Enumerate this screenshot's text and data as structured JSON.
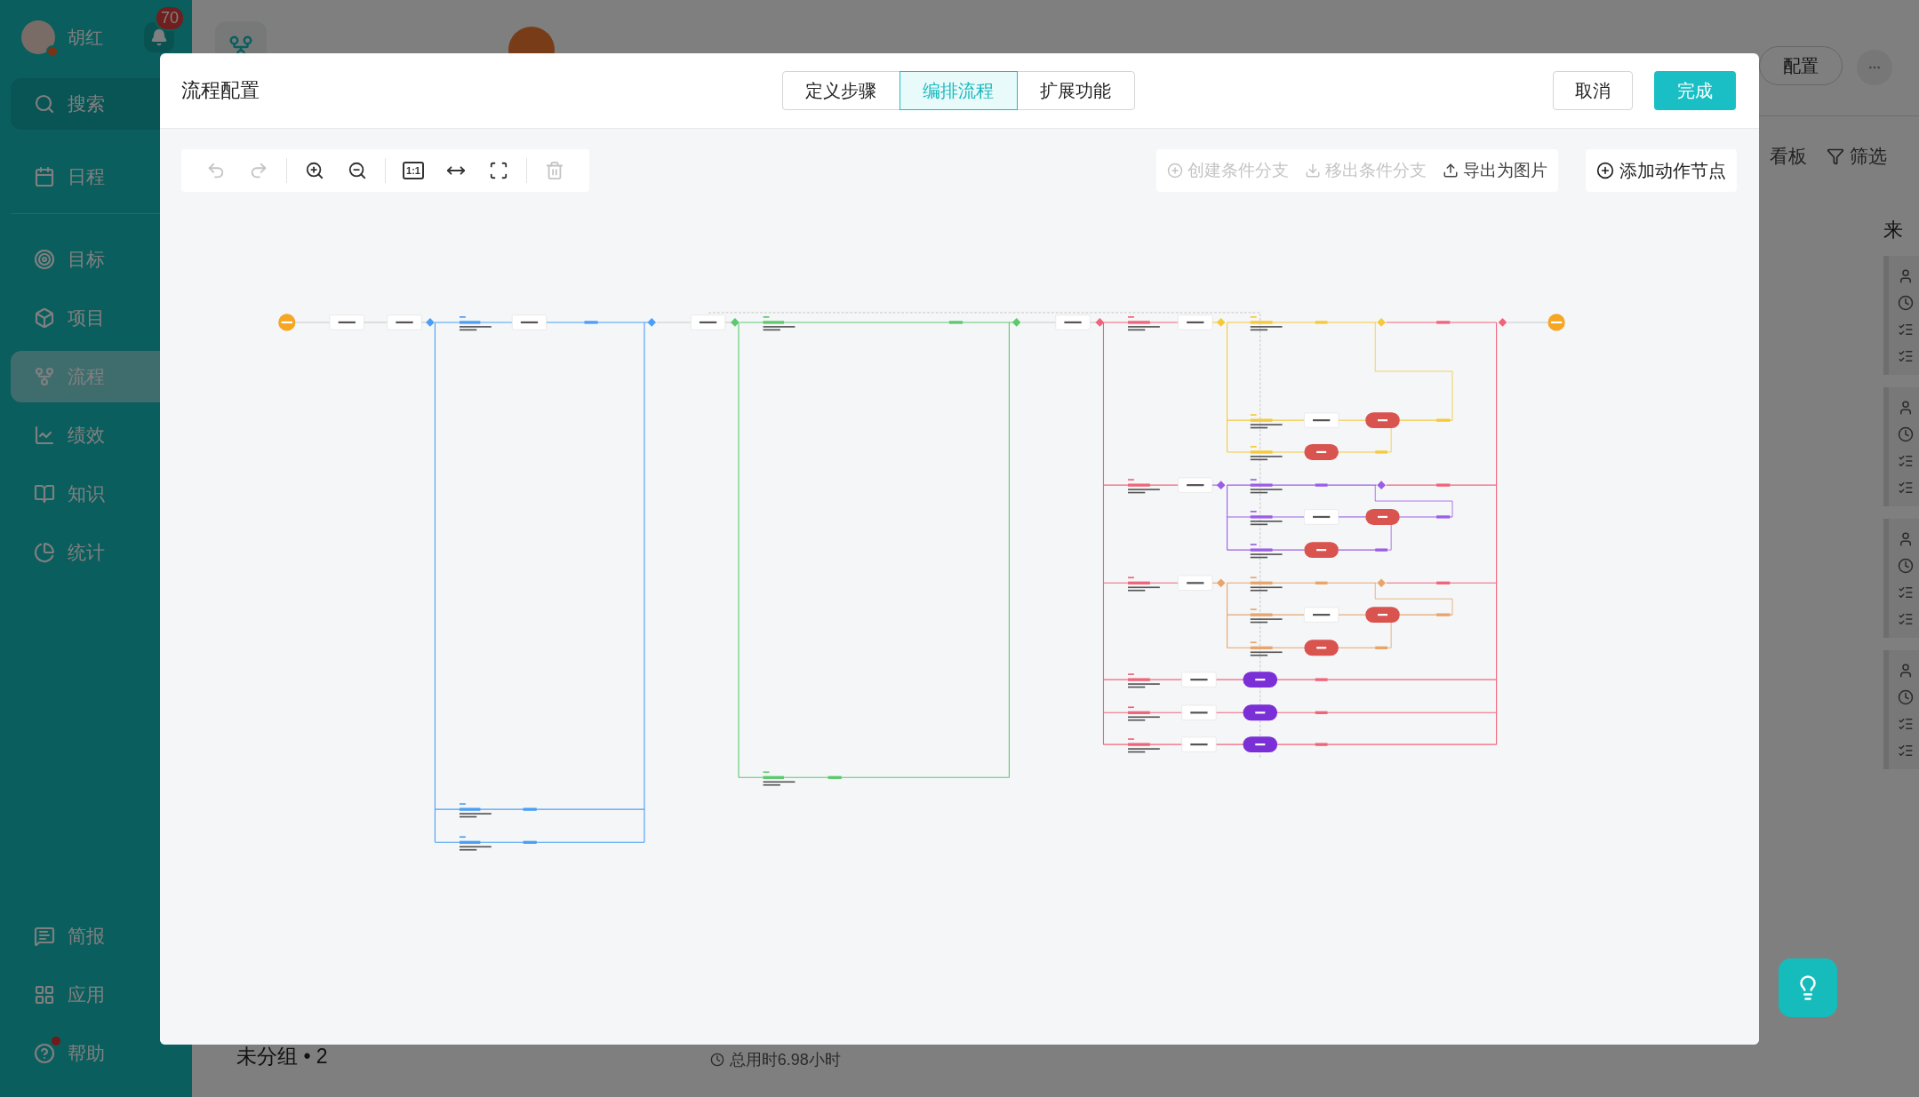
{
  "sidebar": {
    "user": {
      "name": "胡红",
      "notifications": "70"
    },
    "search": {
      "label": "搜索",
      "kind": "search",
      "selected": false
    },
    "top_items": [
      {
        "label": "日程",
        "kind": "calendar",
        "selected": false
      }
    ],
    "main_items": [
      {
        "label": "目标",
        "kind": "target",
        "selected": false
      },
      {
        "label": "项目",
        "kind": "project",
        "selected": false
      },
      {
        "label": "流程",
        "kind": "flow",
        "selected": true
      },
      {
        "label": "绩效",
        "kind": "performance",
        "selected": false
      },
      {
        "label": "知识",
        "kind": "knowledge",
        "selected": false
      },
      {
        "label": "统计",
        "kind": "stats",
        "selected": false
      }
    ],
    "bottom_items": [
      {
        "label": "简报",
        "kind": "report",
        "selected": false,
        "unread": false
      },
      {
        "label": "应用",
        "kind": "apps",
        "selected": false,
        "unread": false
      },
      {
        "label": "帮助",
        "kind": "help",
        "selected": false,
        "unread": true
      }
    ]
  },
  "page": {
    "config_button": "配置",
    "views": [
      {
        "label": "看板",
        "kind": "board"
      },
      {
        "label": "筛选",
        "kind": "filter"
      }
    ],
    "column_heading": "来",
    "group": "未分组 • 2",
    "duration": "总用时6.98小时"
  },
  "modal": {
    "title": "流程配置",
    "tabs": [
      {
        "label": "定义步骤",
        "selected": false
      },
      {
        "label": "编排流程",
        "selected": true
      },
      {
        "label": "扩展功能",
        "selected": false
      }
    ],
    "cancel": "取消",
    "confirm": "完成",
    "tools": [
      {
        "kind": "undo",
        "disabled": true
      },
      {
        "kind": "redo",
        "disabled": true
      },
      {
        "kind": "zoom-in",
        "disabled": false
      },
      {
        "kind": "zoom-out",
        "disabled": false
      },
      {
        "kind": "actual-size",
        "label": "1:1",
        "disabled": false
      },
      {
        "kind": "fit-width",
        "disabled": false
      },
      {
        "kind": "center",
        "disabled": false
      },
      {
        "kind": "delete",
        "disabled": true
      }
    ],
    "actions": [
      {
        "label": "创建条件分支",
        "kind": "add-branch",
        "disabled": true
      },
      {
        "label": "移出条件分支",
        "kind": "remove-branch",
        "disabled": true
      },
      {
        "label": "导出为图片",
        "kind": "export",
        "disabled": false
      }
    ],
    "add_node": "添加动作节点"
  }
}
